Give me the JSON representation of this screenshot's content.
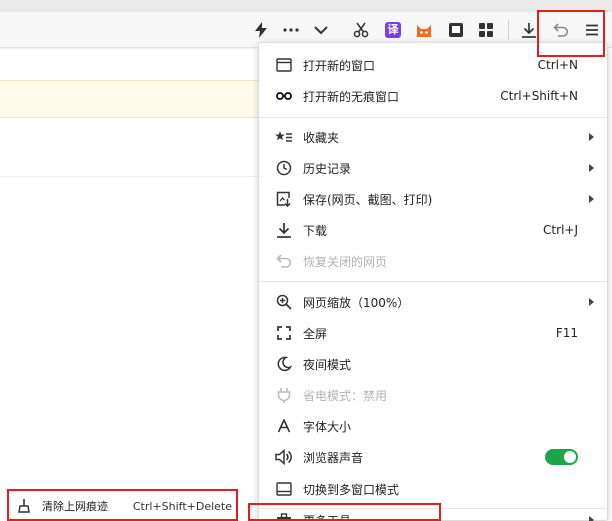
{
  "toolbar": {
    "icons": [
      "lightning-icon",
      "more-icon",
      "chevron-down-icon",
      "scissors-icon",
      "translate-icon",
      "cat-extension-icon",
      "reader-icon",
      "apps-grid-icon",
      "download-icon",
      "undo-icon",
      "menu-icon"
    ],
    "translate_glyph": "译"
  },
  "menu": {
    "items": [
      {
        "label": "打开新的窗口",
        "shortcut": "Ctrl+N",
        "icon": "window-icon"
      },
      {
        "label": "打开新的无痕窗口",
        "shortcut": "Ctrl+Shift+N",
        "icon": "incognito-icon"
      },
      {
        "label": "收藏夹",
        "icon": "star-list-icon"
      },
      {
        "label": "历史记录",
        "icon": "clock-icon"
      },
      {
        "label": "保存(网页、截图、打印)",
        "icon": "save-page-icon"
      },
      {
        "label": "下载",
        "shortcut": "Ctrl+J",
        "icon": "download-icon"
      },
      {
        "label": "恢复关闭的网页",
        "icon": "restore-icon",
        "disabled": true
      },
      {
        "label": "网页缩放（100%）",
        "icon": "zoom-icon"
      },
      {
        "label": "全屏",
        "shortcut": "F11",
        "icon": "fullscreen-icon"
      },
      {
        "label": "夜间模式",
        "icon": "moon-icon"
      },
      {
        "label": "省电模式：禁用",
        "icon": "plug-icon",
        "disabled": true
      },
      {
        "label": "字体大小",
        "icon": "font-size-icon"
      },
      {
        "label": "浏览器声音",
        "icon": "speaker-icon",
        "toggle_on": true
      },
      {
        "label": "切换到多窗口模式",
        "icon": "multi-window-icon"
      },
      {
        "label": "更多工具",
        "icon": "toolbox-icon"
      }
    ]
  },
  "bottom_item": {
    "label": "清除上网痕迹",
    "shortcut": "Ctrl+Shift+Delete",
    "icon": "broom-icon"
  },
  "colors": {
    "highlight": "#e41e1e",
    "toggle_on": "#1fa44a",
    "notice_bg": "#fffbea"
  }
}
